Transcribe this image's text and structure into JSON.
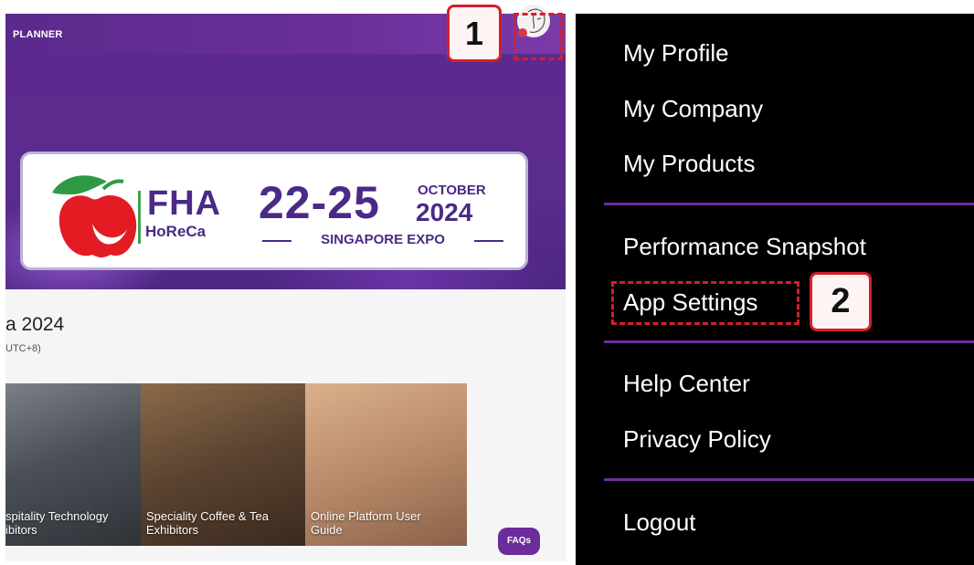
{
  "app": {
    "header_label": "PLANNER"
  },
  "banner": {
    "brand_name": "FHA",
    "brand_sub": "HoReCa",
    "dates": "22-25",
    "month": "OCTOBER",
    "year": "2024",
    "venue": "SINGAPORE EXPO"
  },
  "event": {
    "title": "a 2024",
    "timezone": "UTC+8)"
  },
  "tiles": [
    {
      "label_line1": "spitality Technology",
      "label_line2": "ibitors"
    },
    {
      "label_line1": "Speciality Coffee & Tea",
      "label_line2": "Exhibitors"
    },
    {
      "label_line1": "Online Platform User",
      "label_line2": "Guide"
    }
  ],
  "faq_label": "FAQs",
  "menu": {
    "items": [
      {
        "label": "My Profile"
      },
      {
        "label": "My Company"
      },
      {
        "label": "My Products"
      },
      {
        "label": "Performance Snapshot"
      },
      {
        "label": "App Settings"
      },
      {
        "label": "Help Center"
      },
      {
        "label": "Privacy Policy"
      },
      {
        "label": "Logout"
      }
    ]
  },
  "annotations": {
    "step1": "1",
    "step2": "2"
  },
  "colors": {
    "brand_purple": "#6a2d9b",
    "annotation_red": "#d41f2a",
    "menu_background": "#000000",
    "divider_purple": "#6f2f98"
  }
}
